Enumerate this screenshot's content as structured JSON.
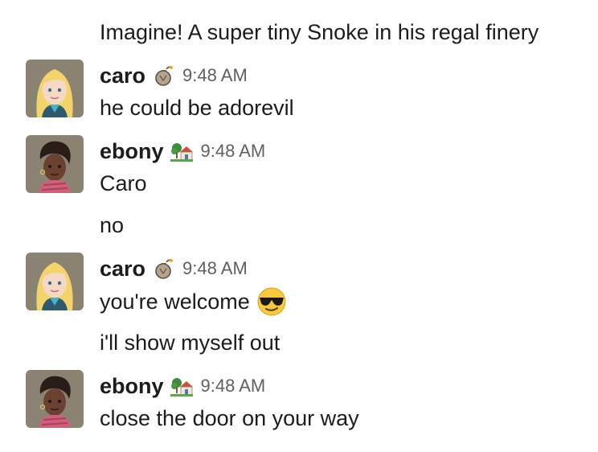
{
  "messages": [
    {
      "type": "continuation",
      "text": "Imagine! A super tiny Snoke in his regal finery"
    },
    {
      "type": "group",
      "author": "caro",
      "status_icon": "bomb-icon",
      "time": "9:48 AM",
      "lines": [
        "he could be adorevil"
      ]
    },
    {
      "type": "group",
      "author": "ebony",
      "status_icon": "house-with-garden-icon",
      "time": "9:48 AM",
      "lines": [
        "Caro",
        "no"
      ]
    },
    {
      "type": "group",
      "author": "caro",
      "status_icon": "bomb-icon",
      "time": "9:48 AM",
      "lines": [
        "you're welcome",
        "i'll show myself out"
      ],
      "inline_emoji": "sunglasses-face-icon"
    },
    {
      "type": "group",
      "author": "ebony",
      "status_icon": "house-with-garden-icon",
      "time": "9:48 AM",
      "lines": [
        "close the door on your way"
      ]
    }
  ],
  "colors": {
    "text": "#1d1c1d",
    "timestamp": "#616061",
    "background": "#ffffff"
  }
}
